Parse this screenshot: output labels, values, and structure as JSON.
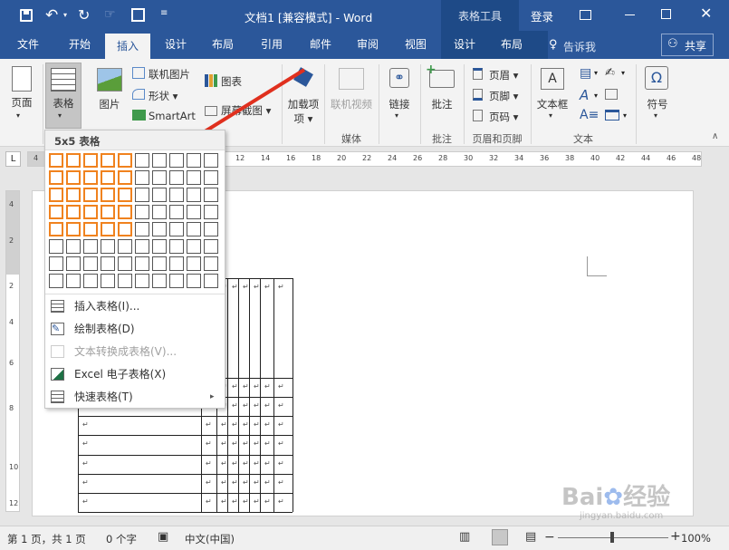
{
  "title": {
    "doc": "文档1 [兼容模式] - Word",
    "context_tab": "表格工具",
    "login": "登录"
  },
  "tabs": [
    {
      "label": "文件"
    },
    {
      "label": "开始"
    },
    {
      "label": "插入"
    },
    {
      "label": "设计"
    },
    {
      "label": "布局"
    },
    {
      "label": "引用"
    },
    {
      "label": "邮件"
    },
    {
      "label": "审阅"
    },
    {
      "label": "视图"
    },
    {
      "label": "设计"
    },
    {
      "label": "布局"
    }
  ],
  "tell_me": "告诉我",
  "share": "共享",
  "ribbon": {
    "page": "页面",
    "table": "表格",
    "picture": "图片",
    "online_picture": "联机图片",
    "shapes": "形状",
    "smartart": "SmartArt",
    "chart": "图表",
    "screenshot": "屏幕截图",
    "addins": "加载项",
    "online_video": "联机视频",
    "link": "链接",
    "comment": "批注",
    "header": "页眉",
    "footer": "页脚",
    "page_number": "页码",
    "textbox": "文本框",
    "symbol": "符号",
    "groups": {
      "media": "媒体",
      "comments": "批注",
      "header_footer": "页眉和页脚",
      "text": "文本"
    }
  },
  "ruler_numbers": [
    "4",
    "12",
    "14",
    "16",
    "18",
    "20",
    "22",
    "24",
    "26",
    "28",
    "30",
    "32",
    "34",
    "36",
    "38",
    "40",
    "42",
    "44",
    "46",
    "48"
  ],
  "vruler_numbers": [
    "4",
    "2",
    "2",
    "4",
    "6",
    "8",
    "10",
    "12"
  ],
  "dropdown": {
    "header": "5x5 表格",
    "grid": {
      "rows": 8,
      "cols": 10,
      "selected_rows": 5,
      "selected_cols": 5
    },
    "items": [
      {
        "label": "插入表格(I)...",
        "disabled": false
      },
      {
        "label": "绘制表格(D)",
        "disabled": false
      },
      {
        "label": "文本转换成表格(V)...",
        "disabled": true
      },
      {
        "label": "Excel 电子表格(X)",
        "disabled": false
      },
      {
        "label": "快速表格(T)",
        "disabled": false
      }
    ]
  },
  "paragraph_mark": "↵",
  "status": {
    "page": "第 1 页，共 1 页",
    "words": "0 个字",
    "language": "中文(中国)",
    "zoom": "100%"
  },
  "colors": {
    "brand": "#2b579a",
    "highlight": "#f0821e",
    "arrow": "#e0301e"
  }
}
